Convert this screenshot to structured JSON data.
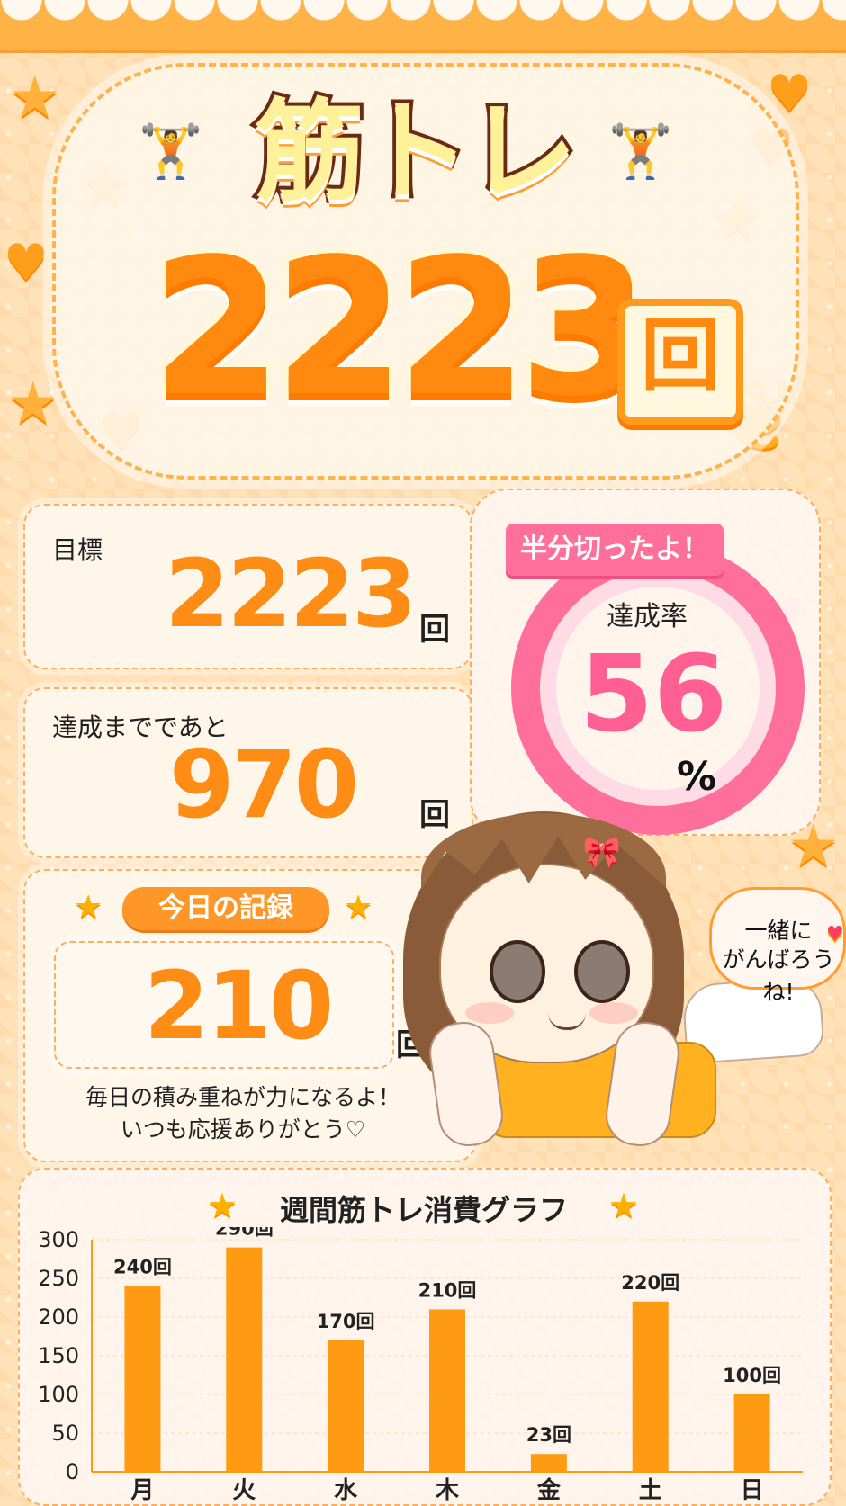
{
  "header": {
    "title": "筋トレ",
    "total_count": "2223",
    "total_unit": "回",
    "lifter_icon": "🏋️"
  },
  "goal": {
    "label": "目標",
    "value": "2223",
    "unit": "回"
  },
  "remaining": {
    "label": "達成までであと",
    "value": "970",
    "unit": "回"
  },
  "progress": {
    "ribbon": "半分切ったよ！",
    "label": "達成率",
    "value": "56",
    "unit": "%",
    "fraction": 0.56
  },
  "today": {
    "badge": "今日の記録",
    "value": "210",
    "unit": "回",
    "message_line_1": "毎日の積み重ねが力になるよ！",
    "message_line_2": "いつも応援ありがとう♡"
  },
  "speech": {
    "line_1": "一緒に",
    "line_2": "がんばろうね!"
  },
  "chart_data": {
    "type": "bar",
    "title": "週間筋トレ消費グラフ",
    "categories": [
      "月",
      "火",
      "水",
      "木",
      "金",
      "土",
      "日"
    ],
    "values": [
      240,
      290,
      170,
      210,
      23,
      220,
      100
    ],
    "value_labels": [
      "240回",
      "290回",
      "170回",
      "210回",
      "23回",
      "220回",
      "100回"
    ],
    "ylim": [
      0,
      300
    ],
    "yticks": [
      0,
      50,
      100,
      150,
      200,
      250,
      300
    ],
    "grid": true,
    "bar_color": "#ff9b12"
  },
  "colors": {
    "accent_orange": "#ff8d15",
    "accent_pink": "#ff6f9c",
    "background": "#ffe2b8"
  }
}
